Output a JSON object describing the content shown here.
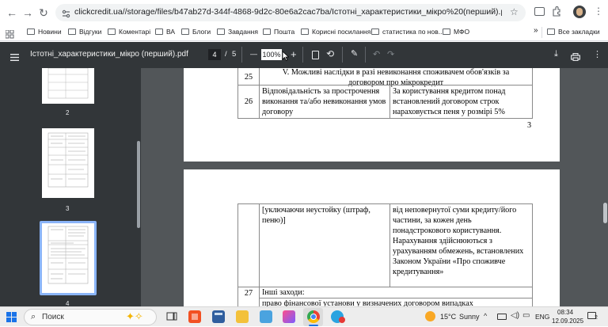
{
  "browser": {
    "url": "clickcredit.ua//storage/files/b47ab27d-344f-4868-9d2c-80e6a2cac7ba/Істотні_характеристики_мікро%20(перший).pdf",
    "bookmarks": [
      "Новини",
      "Відгуки",
      "Коментарі",
      "ВА",
      "Блоги",
      "Завдання",
      "Пошта",
      "Корисні посилання",
      "статистика по нов...",
      "МФО"
    ],
    "more": "»",
    "all_bookmarks": "Все закладки"
  },
  "pdf": {
    "title": "Істотні_характеристики_мікро (перший).pdf",
    "page_current": "4",
    "page_sep": "/",
    "page_total": "5",
    "zoom": "100%",
    "zoom_minus": "—",
    "zoom_plus": "+"
  },
  "thumbs": {
    "n2": "2",
    "n3": "3",
    "n4": "4"
  },
  "doc": {
    "p3": {
      "row25_num": "25",
      "row25_text": "V. Можливі наслідки в разі невиконання споживачем обов'язків за договором про мікрокредит",
      "row26_num": "26",
      "row26_left": "Відповідальність за прострочення виконання та/або невиконання умов договору",
      "row26_right": "За користування кредитом понад встановлений договором строк нараховується пеня у розмірі 5%",
      "page_number": "3"
    },
    "p4": {
      "cont_left": "[уключаючи неустойку (штраф, пеню)]",
      "cont_right": "від неповернутої суми кредиту/його частини, за кожен день понадстрокового користування. Нарахування здійснюються з урахуванням обмежень, встановлених Законом України «Про споживче кредитування»",
      "row27_num": "27",
      "row27_text": "Інші заходи:",
      "row27_sub": "право фінансової установи у визначених договором випадках"
    }
  },
  "taskbar": {
    "search": "Поиск",
    "weather_temp": "15°C",
    "weather_text": "Sunny",
    "lang": "ENG",
    "time": "08:34",
    "date": "12.09.2025",
    "notif": "2"
  }
}
